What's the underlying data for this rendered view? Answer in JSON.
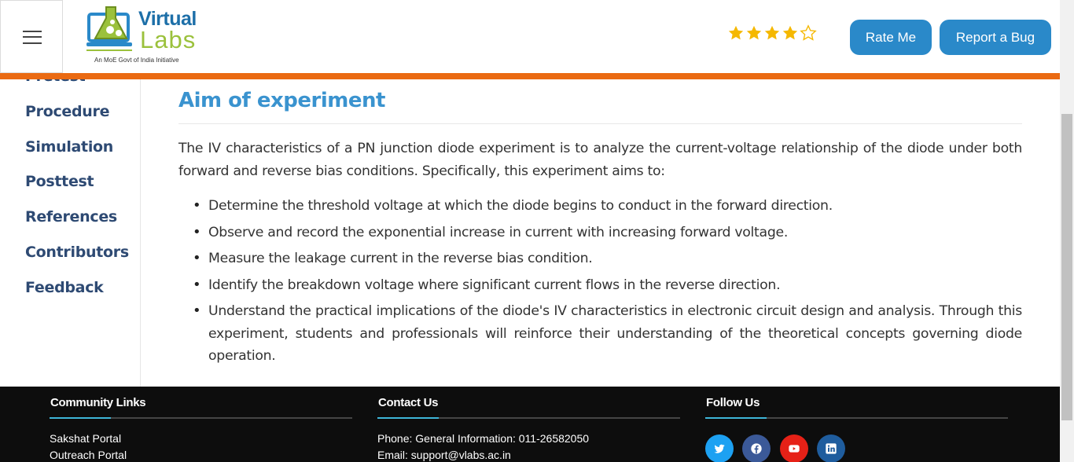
{
  "header": {
    "logo": {
      "main": "Virtual",
      "sub": "Labs",
      "tagline": "An MoE Govt of India Initiative"
    },
    "rating": {
      "value": 4,
      "max": 5,
      "filled_color": "#f5b800"
    },
    "rate_button": "Rate Me",
    "bug_button": "Report a Bug",
    "accent_color": "#ea6a12"
  },
  "sidebar": {
    "items": [
      {
        "label": "Pretest"
      },
      {
        "label": "Procedure"
      },
      {
        "label": "Simulation"
      },
      {
        "label": "Posttest"
      },
      {
        "label": "References"
      },
      {
        "label": "Contributors"
      },
      {
        "label": "Feedback"
      }
    ]
  },
  "main": {
    "title": "Aim of experiment",
    "intro": "The IV characteristics of a PN junction diode experiment is to analyze the current-voltage relationship of the diode under both forward and reverse bias conditions. Specifically, this experiment aims to:",
    "bullets": [
      "Determine the threshold voltage at which the diode begins to conduct in the forward direction.",
      "Observe and record the exponential increase in current with increasing forward voltage.",
      "Measure the leakage current in the reverse bias condition.",
      "Identify the breakdown voltage where significant current flows in the reverse direction.",
      "Understand the practical implications of the diode's IV characteristics in electronic circuit design and analysis. Through this experiment, students and professionals will reinforce their understanding of the theoretical concepts governing diode operation."
    ]
  },
  "footer": {
    "community": {
      "heading": "Community Links",
      "links": [
        "Sakshat Portal",
        "Outreach Portal"
      ]
    },
    "contact": {
      "heading": "Contact Us",
      "phone": "Phone: General Information: 011-26582050",
      "email": "Email: support@vlabs.ac.in"
    },
    "follow": {
      "heading": "Follow Us",
      "icons": [
        "twitter-icon",
        "facebook-icon",
        "youtube-icon",
        "linkedin-icon"
      ]
    }
  }
}
